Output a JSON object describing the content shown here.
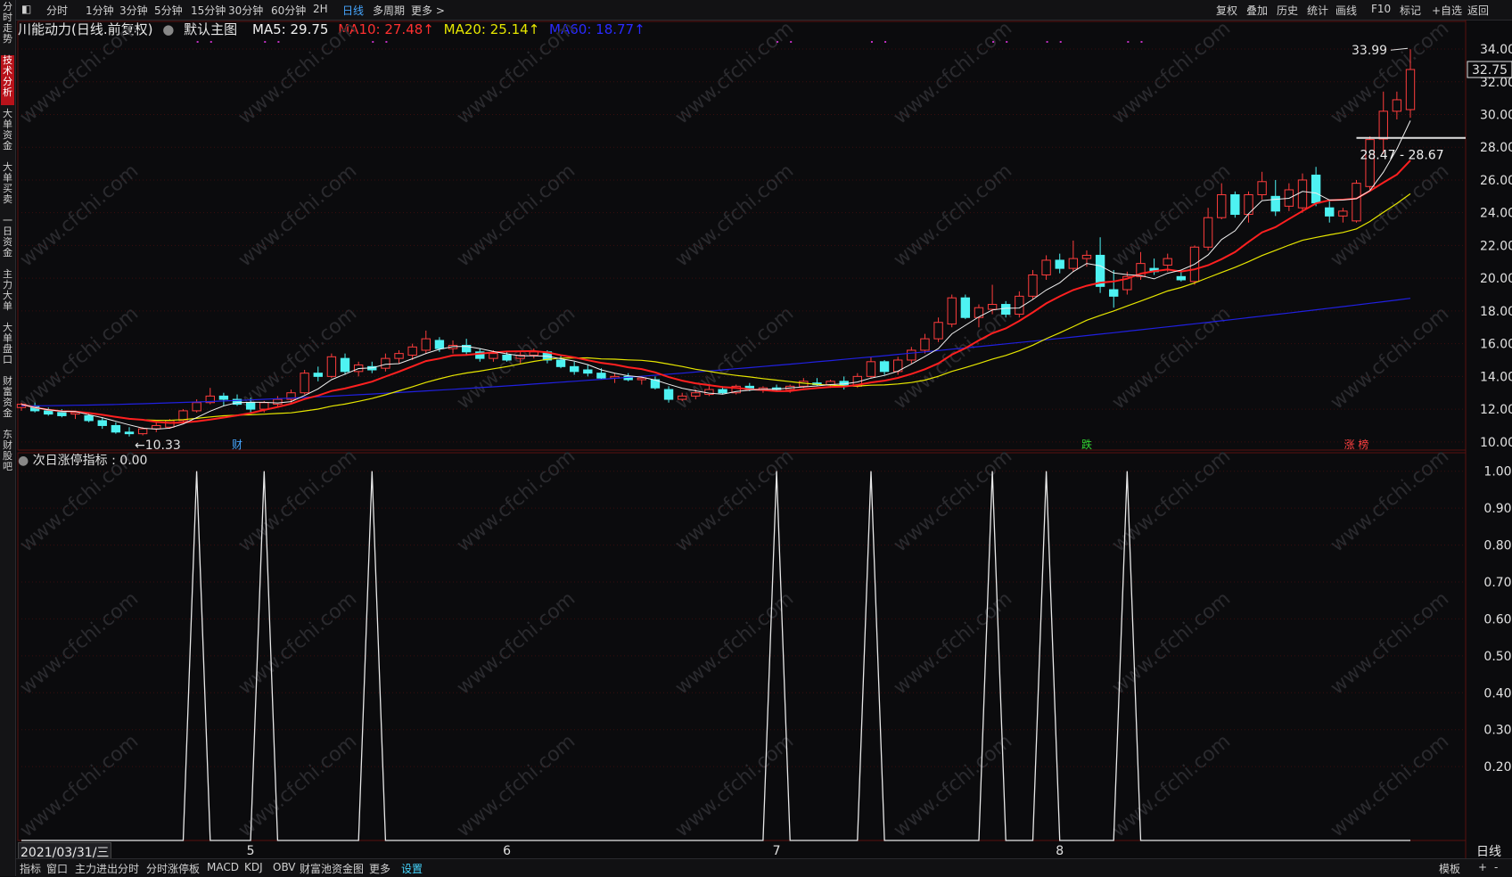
{
  "toolbar": {
    "left_items": [
      "分时",
      "1分钟",
      "3分钟",
      "5分钟",
      "15分钟",
      "30分钟",
      "60分钟",
      "2H",
      "日线",
      "多周期",
      "更多 >"
    ],
    "active": "日线",
    "right_items": [
      "复权",
      "叠加",
      "历史",
      "统计",
      "画线",
      "F10",
      "标记",
      "+自选",
      "返回"
    ]
  },
  "side_tabs": [
    {
      "label": "分时走势",
      "active": false
    },
    {
      "label": "技术分析",
      "active": true
    },
    {
      "label": "大单资金",
      "active": false
    },
    {
      "label": "大单买卖",
      "active": false
    },
    {
      "label": "一日资金",
      "active": false
    },
    {
      "label": "主力大单",
      "active": false
    },
    {
      "label": "大单盘口",
      "active": false
    },
    {
      "label": "财富资金",
      "active": false
    },
    {
      "label": "东财股吧",
      "active": false
    }
  ],
  "legend": {
    "title": "川能动力(日线.前复权)",
    "main_chart": "默认主图",
    "ma5": "MA5: 29.75",
    "ma10": "MA10: 27.48↑",
    "ma20": "MA20: 25.14↑",
    "ma60": "MA60: 18.77↑"
  },
  "indicator_legend": "次日涨停指标 : 0.00",
  "date_label": "2021/03/31/三",
  "bottom_bar": {
    "items": [
      "指标",
      "窗口",
      "主力进出分时",
      "分时涨停板",
      "MACD",
      "KDJ",
      "OBV",
      "财富池资金图",
      "更多",
      "设置"
    ],
    "active": "设置",
    "right_items": [
      "模板",
      "+",
      "-"
    ],
    "period": "日线"
  },
  "annotations": {
    "high": "33.99",
    "low": "10.33",
    "current_price": "32.75",
    "range_label": "28.47 - 28.67",
    "markers": [
      "财",
      "跌",
      "涨 榜"
    ]
  },
  "watermark": "www.cfchi.com",
  "colors": {
    "up": "#ff3d3d",
    "down": "#4ef2f2",
    "ma5": "#f0f0f0",
    "ma10": "#ff2020",
    "ma20": "#e6e600",
    "ma60": "#2020e0",
    "indicator": "#e8e8e8"
  },
  "chart_data": [
    {
      "type": "candlestick",
      "title": "川能动力(日线.前复权)",
      "y_ticks": [
        "34.00",
        "32.00",
        "30.00",
        "28.00",
        "26.00",
        "24.00",
        "22.00",
        "20.00",
        "18.00",
        "16.00",
        "14.00",
        "12.00",
        "10.00"
      ],
      "ylim": [
        9.5,
        34.6
      ],
      "x_tick_labels": [
        "5",
        "6",
        "7",
        "8"
      ],
      "candles": [
        {
          "o": 12.1,
          "h": 12.4,
          "l": 11.9,
          "c": 12.3
        },
        {
          "o": 12.2,
          "h": 12.4,
          "l": 11.8,
          "c": 11.9
        },
        {
          "o": 11.9,
          "h": 12.1,
          "l": 11.6,
          "c": 11.7
        },
        {
          "o": 11.8,
          "h": 12.0,
          "l": 11.5,
          "c": 11.6
        },
        {
          "o": 11.7,
          "h": 11.9,
          "l": 11.4,
          "c": 11.8
        },
        {
          "o": 11.6,
          "h": 11.8,
          "l": 11.2,
          "c": 11.3
        },
        {
          "o": 11.3,
          "h": 11.5,
          "l": 10.8,
          "c": 11.0
        },
        {
          "o": 11.0,
          "h": 11.2,
          "l": 10.5,
          "c": 10.6
        },
        {
          "o": 10.6,
          "h": 10.9,
          "l": 10.33,
          "c": 10.5
        },
        {
          "o": 10.5,
          "h": 10.9,
          "l": 10.4,
          "c": 10.8
        },
        {
          "o": 10.8,
          "h": 11.2,
          "l": 10.6,
          "c": 11.0
        },
        {
          "o": 10.9,
          "h": 11.4,
          "l": 10.8,
          "c": 11.3
        },
        {
          "o": 11.3,
          "h": 12.0,
          "l": 11.2,
          "c": 11.9
        },
        {
          "o": 11.9,
          "h": 12.6,
          "l": 11.8,
          "c": 12.4
        },
        {
          "o": 12.4,
          "h": 13.3,
          "l": 12.3,
          "c": 12.8
        },
        {
          "o": 12.8,
          "h": 13.0,
          "l": 12.2,
          "c": 12.6
        },
        {
          "o": 12.6,
          "h": 12.9,
          "l": 12.2,
          "c": 12.3
        },
        {
          "o": 12.4,
          "h": 12.7,
          "l": 11.8,
          "c": 12.0
        },
        {
          "o": 12.0,
          "h": 12.5,
          "l": 11.8,
          "c": 12.4
        },
        {
          "o": 12.3,
          "h": 12.8,
          "l": 12.1,
          "c": 12.6
        },
        {
          "o": 12.6,
          "h": 13.2,
          "l": 12.4,
          "c": 13.0
        },
        {
          "o": 13.0,
          "h": 14.4,
          "l": 12.9,
          "c": 14.2
        },
        {
          "o": 14.2,
          "h": 14.6,
          "l": 13.7,
          "c": 14.0
        },
        {
          "o": 14.0,
          "h": 15.4,
          "l": 13.9,
          "c": 15.2
        },
        {
          "o": 15.1,
          "h": 15.4,
          "l": 14.1,
          "c": 14.3
        },
        {
          "o": 14.3,
          "h": 14.9,
          "l": 14.0,
          "c": 14.7
        },
        {
          "o": 14.6,
          "h": 14.9,
          "l": 14.2,
          "c": 14.4
        },
        {
          "o": 14.5,
          "h": 15.4,
          "l": 14.3,
          "c": 15.1
        },
        {
          "o": 15.1,
          "h": 15.6,
          "l": 14.8,
          "c": 15.4
        },
        {
          "o": 15.3,
          "h": 16.0,
          "l": 15.0,
          "c": 15.8
        },
        {
          "o": 15.6,
          "h": 16.8,
          "l": 15.4,
          "c": 16.3
        },
        {
          "o": 16.2,
          "h": 16.4,
          "l": 15.5,
          "c": 15.7
        },
        {
          "o": 15.7,
          "h": 16.2,
          "l": 15.4,
          "c": 15.9
        },
        {
          "o": 15.9,
          "h": 16.3,
          "l": 15.3,
          "c": 15.5
        },
        {
          "o": 15.5,
          "h": 15.7,
          "l": 14.9,
          "c": 15.1
        },
        {
          "o": 15.1,
          "h": 15.6,
          "l": 14.9,
          "c": 15.4
        },
        {
          "o": 15.3,
          "h": 15.5,
          "l": 14.9,
          "c": 15.0
        },
        {
          "o": 15.1,
          "h": 15.5,
          "l": 14.8,
          "c": 15.3
        },
        {
          "o": 15.3,
          "h": 15.7,
          "l": 15.1,
          "c": 15.5
        },
        {
          "o": 15.5,
          "h": 15.6,
          "l": 14.8,
          "c": 15.0
        },
        {
          "o": 15.0,
          "h": 15.3,
          "l": 14.5,
          "c": 14.6
        },
        {
          "o": 14.6,
          "h": 14.9,
          "l": 14.1,
          "c": 14.3
        },
        {
          "o": 14.4,
          "h": 14.7,
          "l": 14.0,
          "c": 14.2
        },
        {
          "o": 14.2,
          "h": 14.5,
          "l": 13.8,
          "c": 13.9
        },
        {
          "o": 13.9,
          "h": 14.2,
          "l": 13.6,
          "c": 14.0
        },
        {
          "o": 14.0,
          "h": 14.2,
          "l": 13.7,
          "c": 13.8
        },
        {
          "o": 13.8,
          "h": 14.0,
          "l": 13.5,
          "c": 13.9
        },
        {
          "o": 13.8,
          "h": 14.0,
          "l": 13.2,
          "c": 13.3
        },
        {
          "o": 13.2,
          "h": 13.4,
          "l": 12.4,
          "c": 12.6
        },
        {
          "o": 12.6,
          "h": 13.0,
          "l": 12.5,
          "c": 12.8
        },
        {
          "o": 12.8,
          "h": 13.2,
          "l": 12.6,
          "c": 13.0
        },
        {
          "o": 12.9,
          "h": 13.4,
          "l": 12.8,
          "c": 13.2
        },
        {
          "o": 13.2,
          "h": 13.4,
          "l": 12.9,
          "c": 13.0
        },
        {
          "o": 13.0,
          "h": 13.5,
          "l": 12.9,
          "c": 13.4
        },
        {
          "o": 13.4,
          "h": 13.6,
          "l": 13.1,
          "c": 13.2
        },
        {
          "o": 13.2,
          "h": 13.4,
          "l": 13.0,
          "c": 13.3
        },
        {
          "o": 13.3,
          "h": 13.5,
          "l": 13.1,
          "c": 13.2
        },
        {
          "o": 13.2,
          "h": 13.5,
          "l": 13.0,
          "c": 13.4
        },
        {
          "o": 13.4,
          "h": 13.9,
          "l": 13.3,
          "c": 13.7
        },
        {
          "o": 13.6,
          "h": 13.9,
          "l": 13.4,
          "c": 13.5
        },
        {
          "o": 13.5,
          "h": 13.8,
          "l": 13.3,
          "c": 13.7
        },
        {
          "o": 13.7,
          "h": 14.0,
          "l": 13.2,
          "c": 13.4
        },
        {
          "o": 13.4,
          "h": 14.2,
          "l": 13.3,
          "c": 14.0
        },
        {
          "o": 14.0,
          "h": 15.2,
          "l": 13.9,
          "c": 14.9
        },
        {
          "o": 14.9,
          "h": 15.0,
          "l": 14.1,
          "c": 14.3
        },
        {
          "o": 14.3,
          "h": 15.2,
          "l": 14.1,
          "c": 15.0
        },
        {
          "o": 15.0,
          "h": 15.8,
          "l": 14.8,
          "c": 15.6
        },
        {
          "o": 15.6,
          "h": 16.6,
          "l": 15.4,
          "c": 16.3
        },
        {
          "o": 16.3,
          "h": 17.6,
          "l": 16.1,
          "c": 17.3
        },
        {
          "o": 17.2,
          "h": 19.0,
          "l": 17.0,
          "c": 18.8
        },
        {
          "o": 18.8,
          "h": 19.0,
          "l": 17.5,
          "c": 17.6
        },
        {
          "o": 17.6,
          "h": 18.4,
          "l": 17.0,
          "c": 18.2
        },
        {
          "o": 18.1,
          "h": 19.6,
          "l": 17.8,
          "c": 18.4
        },
        {
          "o": 18.4,
          "h": 18.6,
          "l": 17.6,
          "c": 17.8
        },
        {
          "o": 17.8,
          "h": 19.2,
          "l": 17.6,
          "c": 18.9
        },
        {
          "o": 18.9,
          "h": 20.5,
          "l": 18.7,
          "c": 20.2
        },
        {
          "o": 20.2,
          "h": 21.4,
          "l": 19.9,
          "c": 21.1
        },
        {
          "o": 21.1,
          "h": 21.5,
          "l": 20.3,
          "c": 20.6
        },
        {
          "o": 20.6,
          "h": 22.3,
          "l": 20.4,
          "c": 21.2
        },
        {
          "o": 21.2,
          "h": 21.7,
          "l": 20.7,
          "c": 21.4
        },
        {
          "o": 21.4,
          "h": 22.5,
          "l": 19.1,
          "c": 19.5
        },
        {
          "o": 19.3,
          "h": 20.5,
          "l": 18.2,
          "c": 18.9
        },
        {
          "o": 19.3,
          "h": 20.4,
          "l": 19.0,
          "c": 20.1
        },
        {
          "o": 20.1,
          "h": 21.6,
          "l": 19.9,
          "c": 20.9
        },
        {
          "o": 20.6,
          "h": 21.2,
          "l": 20.2,
          "c": 20.4
        },
        {
          "o": 20.8,
          "h": 21.5,
          "l": 20.4,
          "c": 21.2
        },
        {
          "o": 20.1,
          "h": 20.4,
          "l": 19.8,
          "c": 19.9
        },
        {
          "o": 19.8,
          "h": 22.0,
          "l": 19.6,
          "c": 21.9
        },
        {
          "o": 21.9,
          "h": 24.3,
          "l": 21.7,
          "c": 23.7
        },
        {
          "o": 23.7,
          "h": 25.8,
          "l": 23.6,
          "c": 25.1
        },
        {
          "o": 25.1,
          "h": 25.3,
          "l": 23.7,
          "c": 23.9
        },
        {
          "o": 23.9,
          "h": 25.3,
          "l": 23.4,
          "c": 25.1
        },
        {
          "o": 25.1,
          "h": 26.5,
          "l": 24.8,
          "c": 25.9
        },
        {
          "o": 25.0,
          "h": 26.0,
          "l": 23.8,
          "c": 24.1
        },
        {
          "o": 24.4,
          "h": 25.8,
          "l": 24.1,
          "c": 25.4
        },
        {
          "o": 24.3,
          "h": 26.4,
          "l": 24.0,
          "c": 26.0
        },
        {
          "o": 26.3,
          "h": 26.8,
          "l": 24.4,
          "c": 24.6
        },
        {
          "o": 24.3,
          "h": 24.7,
          "l": 23.4,
          "c": 23.8
        },
        {
          "o": 23.8,
          "h": 24.3,
          "l": 23.4,
          "c": 24.1
        },
        {
          "o": 23.5,
          "h": 26.0,
          "l": 23.4,
          "c": 25.8
        },
        {
          "o": 25.6,
          "h": 28.67,
          "l": 25.3,
          "c": 28.47
        },
        {
          "o": 28.5,
          "h": 31.4,
          "l": 27.6,
          "c": 30.2
        },
        {
          "o": 30.2,
          "h": 31.4,
          "l": 29.7,
          "c": 30.9
        },
        {
          "o": 30.3,
          "h": 33.99,
          "l": 29.8,
          "c": 32.75
        }
      ],
      "ma60_start": 12.2,
      "ma60_end": 18.77,
      "indicator": {
        "name": "次日涨停指标",
        "ylim": [
          0,
          1.05
        ],
        "y_ticks": [
          "1.00",
          "0.90",
          "0.80",
          "0.70",
          "0.60",
          "0.50",
          "0.40",
          "0.30",
          "0.20"
        ],
        "spike_indices": [
          13,
          18,
          26,
          56,
          63,
          72,
          76,
          82
        ]
      }
    }
  ]
}
